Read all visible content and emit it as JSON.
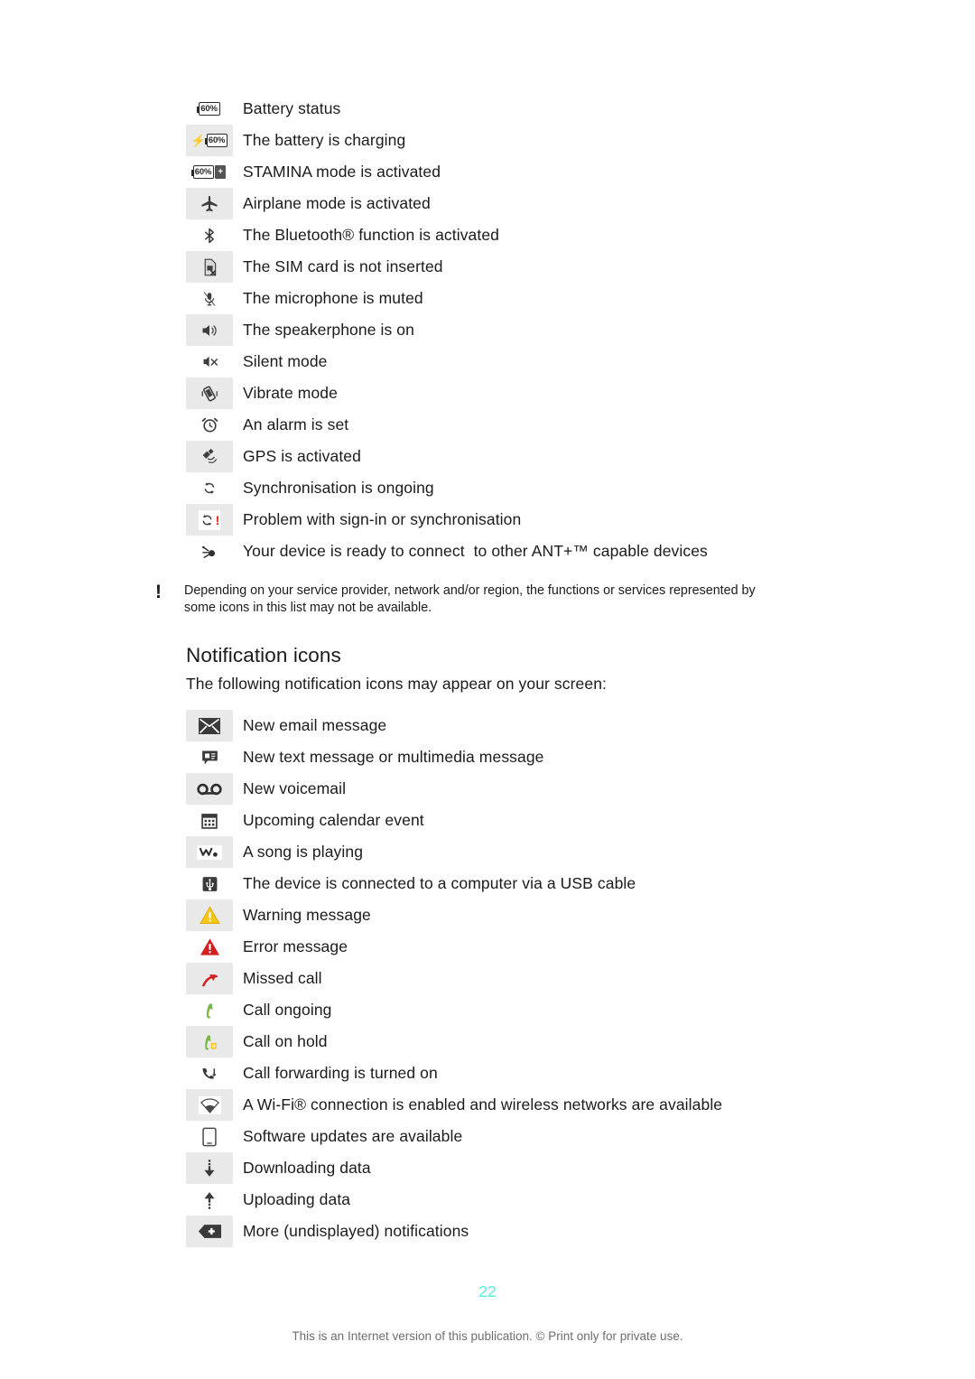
{
  "document": {
    "page_number": "22",
    "footer_note": "This is an Internet version of this publication. © Print only for private use."
  },
  "status_icons": {
    "rows": [
      {
        "icon": "battery-status-icon",
        "label": "Battery status",
        "value": "60%"
      },
      {
        "icon": "battery-charging-icon",
        "label": "The battery is charging",
        "value": "60%"
      },
      {
        "icon": "stamina-mode-icon",
        "label": "STAMINA mode is activated",
        "value": "60%"
      },
      {
        "icon": "airplane-mode-icon",
        "label": "Airplane mode is activated"
      },
      {
        "icon": "bluetooth-icon",
        "label": "The Bluetooth® function is activated"
      },
      {
        "icon": "sim-card-missing-icon",
        "label": "The SIM card is not inserted"
      },
      {
        "icon": "microphone-muted-icon",
        "label": "The microphone is muted"
      },
      {
        "icon": "speakerphone-icon",
        "label": "The speakerphone is on"
      },
      {
        "icon": "silent-mode-icon",
        "label": "Silent mode"
      },
      {
        "icon": "vibrate-mode-icon",
        "label": "Vibrate mode"
      },
      {
        "icon": "alarm-icon",
        "label": "An alarm is set"
      },
      {
        "icon": "gps-icon",
        "label": "GPS is activated"
      },
      {
        "icon": "sync-icon",
        "label": "Synchronisation is ongoing"
      },
      {
        "icon": "sync-problem-icon",
        "label": "Problem with sign-in or synchronisation"
      },
      {
        "icon": "ant-plus-icon",
        "label": "Your device is ready to connect  to other ANT+™ capable devices"
      }
    ]
  },
  "note": {
    "marker": "!",
    "text": "Depending on your service provider, network and/or region, the functions or services represented by some icons in this list may not be available."
  },
  "notification_section": {
    "heading": "Notification icons",
    "intro": "The following notification icons may appear on your screen:",
    "rows": [
      {
        "icon": "new-email-icon",
        "label": "New email message"
      },
      {
        "icon": "new-text-message-icon",
        "label": "New text message or multimedia message"
      },
      {
        "icon": "new-voicemail-icon",
        "label": "New voicemail"
      },
      {
        "icon": "calendar-event-icon",
        "label": "Upcoming calendar event"
      },
      {
        "icon": "music-playing-icon",
        "label": "A song is playing"
      },
      {
        "icon": "usb-connected-icon",
        "label": "The device is connected to a computer via a USB cable"
      },
      {
        "icon": "warning-icon",
        "label": "Warning message"
      },
      {
        "icon": "error-icon",
        "label": "Error message"
      },
      {
        "icon": "missed-call-icon",
        "label": "Missed call"
      },
      {
        "icon": "call-ongoing-icon",
        "label": "Call ongoing"
      },
      {
        "icon": "call-on-hold-icon",
        "label": "Call on hold"
      },
      {
        "icon": "call-forwarding-icon",
        "label": "Call forwarding is turned on"
      },
      {
        "icon": "wifi-icon",
        "label": "A Wi-Fi® connection is enabled and wireless networks are available"
      },
      {
        "icon": "software-update-icon",
        "label": "Software updates are available"
      },
      {
        "icon": "downloading-icon",
        "label": "Downloading data"
      },
      {
        "icon": "uploading-icon",
        "label": "Uploading data"
      },
      {
        "icon": "more-notifications-icon",
        "label": "More (undisplayed) notifications"
      }
    ]
  },
  "colors": {
    "page_number": "#4ef3dd",
    "warning": "#f5c518",
    "error": "#d21f1f",
    "call": "#7ab648",
    "shade": "#e9e9e9",
    "text": "#1b1b1b"
  }
}
